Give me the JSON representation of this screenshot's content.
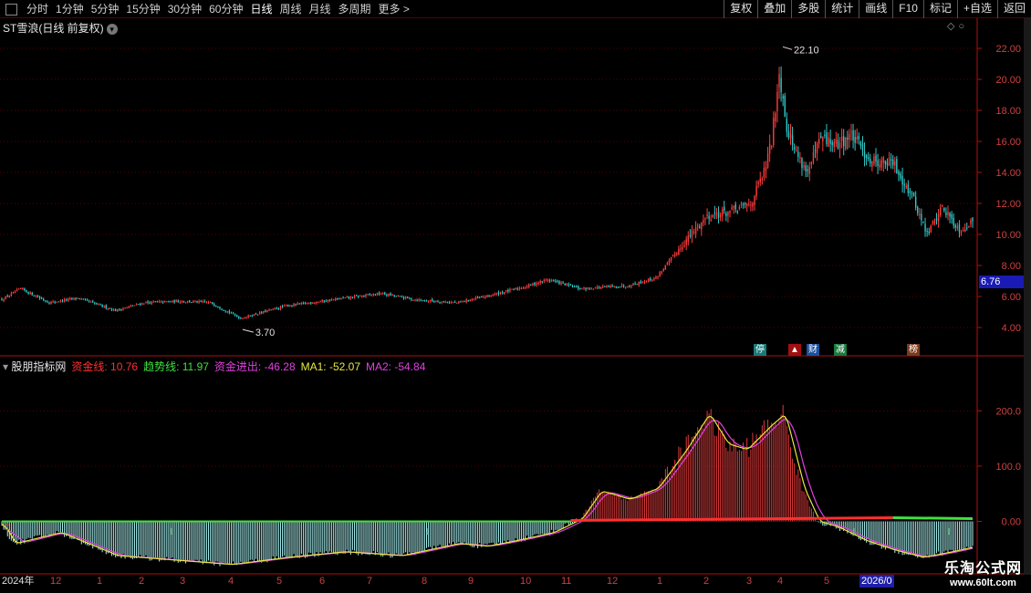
{
  "toolbar": {
    "periods": [
      "分时",
      "1分钟",
      "5分钟",
      "15分钟",
      "30分钟",
      "60分钟",
      "日线",
      "周线",
      "月线",
      "多周期",
      "更多 >"
    ],
    "active_period": "日线",
    "right_buttons": [
      "复权",
      "叠加",
      "多股",
      "统计",
      "画线",
      "F10",
      "标记",
      "+自选",
      "返回"
    ]
  },
  "main_panel": {
    "title": "ST雪浪(日线 前复权)",
    "high_marker": "22.10",
    "low_marker": "3.70",
    "current_price": "6.76",
    "y_ticks": [
      "22.00",
      "20.00",
      "18.00",
      "16.00",
      "14.00",
      "12.00",
      "10.00",
      "8.00",
      "6.00",
      "4.00"
    ]
  },
  "badges": [
    {
      "label": "停",
      "color": "#1a7a7a"
    },
    {
      "label": "▲",
      "color": "#a01010"
    },
    {
      "label": "财",
      "color": "#1a50a0"
    },
    {
      "label": "减",
      "color": "#1a7a40"
    },
    {
      "label": "榜",
      "color": "#7a3a1a"
    }
  ],
  "indicator": {
    "name": "股朋指标网",
    "fields": [
      {
        "label": "资金线:",
        "value": "10.76",
        "color": "#ff3030"
      },
      {
        "label": "趋势线:",
        "value": "11.97",
        "color": "#40e040"
      },
      {
        "label": "资金进出:",
        "value": "-46.28",
        "color": "#e040e0"
      },
      {
        "label": "MA1:",
        "value": "-52.07",
        "color": "#e8e840"
      },
      {
        "label": "MA2:",
        "value": "-54.84",
        "color": "#e040e0"
      }
    ],
    "y_ticks": [
      "200.0",
      "100.0",
      "0.00"
    ]
  },
  "x_axis": {
    "labels": [
      "2024年",
      "12",
      "1",
      "2",
      "3",
      "4",
      "5",
      "6",
      "7",
      "8",
      "9",
      "10",
      "11",
      "12",
      "1",
      "2",
      "3",
      "4",
      "5",
      "2026/0"
    ]
  },
  "watermark": {
    "line1": "乐淘公式网",
    "line2": "www.60lt.com"
  },
  "colors": {
    "up": "#ff3c3c",
    "down": "#30c8c8",
    "axis": "#b01010",
    "grid": "#5a0000"
  },
  "chart_data": {
    "type": "candlestick+histogram",
    "price_ylim": [
      3.0,
      23.0
    ],
    "price_keypoints": [
      {
        "i": 0,
        "close": 5.8
      },
      {
        "i": 10,
        "close": 6.5
      },
      {
        "i": 25,
        "close": 5.6
      },
      {
        "i": 40,
        "close": 5.9
      },
      {
        "i": 60,
        "close": 5.1
      },
      {
        "i": 75,
        "close": 5.6
      },
      {
        "i": 95,
        "close": 5.7
      },
      {
        "i": 110,
        "close": 5.6
      },
      {
        "i": 126,
        "close": 4.6
      },
      {
        "i": 150,
        "close": 5.4
      },
      {
        "i": 175,
        "close": 5.8
      },
      {
        "i": 200,
        "close": 6.2
      },
      {
        "i": 218,
        "close": 5.8
      },
      {
        "i": 240,
        "close": 5.6
      },
      {
        "i": 255,
        "close": 6.0
      },
      {
        "i": 275,
        "close": 6.6
      },
      {
        "i": 288,
        "close": 7.1
      },
      {
        "i": 305,
        "close": 6.5
      },
      {
        "i": 330,
        "close": 6.7
      },
      {
        "i": 345,
        "close": 7.2
      },
      {
        "i": 360,
        "close": 9.5
      },
      {
        "i": 372,
        "close": 11.2
      },
      {
        "i": 385,
        "close": 11.5
      },
      {
        "i": 395,
        "close": 12.0
      },
      {
        "i": 402,
        "close": 14.0
      },
      {
        "i": 406,
        "close": 16.0
      },
      {
        "i": 410,
        "close": 20.5
      },
      {
        "i": 414,
        "close": 17.0
      },
      {
        "i": 418,
        "close": 15.5
      },
      {
        "i": 425,
        "close": 14.0
      },
      {
        "i": 432,
        "close": 16.2
      },
      {
        "i": 440,
        "close": 15.8
      },
      {
        "i": 448,
        "close": 16.4
      },
      {
        "i": 458,
        "close": 14.8
      },
      {
        "i": 470,
        "close": 14.6
      },
      {
        "i": 480,
        "close": 12.5
      },
      {
        "i": 488,
        "close": 10.0
      },
      {
        "i": 496,
        "close": 11.8
      },
      {
        "i": 505,
        "close": 10.3
      },
      {
        "i": 512,
        "close": 10.8
      }
    ],
    "indicator_ylim": [
      -90,
      270
    ],
    "indicator_keypoints": [
      {
        "i": 0,
        "v": -5
      },
      {
        "i": 6,
        "v": -40
      },
      {
        "i": 12,
        "v": -35
      },
      {
        "i": 30,
        "v": -20
      },
      {
        "i": 60,
        "v": -62
      },
      {
        "i": 90,
        "v": -70
      },
      {
        "i": 120,
        "v": -78
      },
      {
        "i": 150,
        "v": -65
      },
      {
        "i": 180,
        "v": -55
      },
      {
        "i": 210,
        "v": -62
      },
      {
        "i": 240,
        "v": -40
      },
      {
        "i": 255,
        "v": -45
      },
      {
        "i": 270,
        "v": -35
      },
      {
        "i": 290,
        "v": -20
      },
      {
        "i": 305,
        "v": 5
      },
      {
        "i": 315,
        "v": 55
      },
      {
        "i": 330,
        "v": 40
      },
      {
        "i": 345,
        "v": 60
      },
      {
        "i": 360,
        "v": 130
      },
      {
        "i": 372,
        "v": 195
      },
      {
        "i": 382,
        "v": 140
      },
      {
        "i": 392,
        "v": 130
      },
      {
        "i": 405,
        "v": 175
      },
      {
        "i": 412,
        "v": 195
      },
      {
        "i": 422,
        "v": 60
      },
      {
        "i": 430,
        "v": 0
      },
      {
        "i": 440,
        "v": -10
      },
      {
        "i": 455,
        "v": -35
      },
      {
        "i": 470,
        "v": -52
      },
      {
        "i": 485,
        "v": -65
      },
      {
        "i": 500,
        "v": -55
      },
      {
        "i": 512,
        "v": -46
      }
    ]
  }
}
